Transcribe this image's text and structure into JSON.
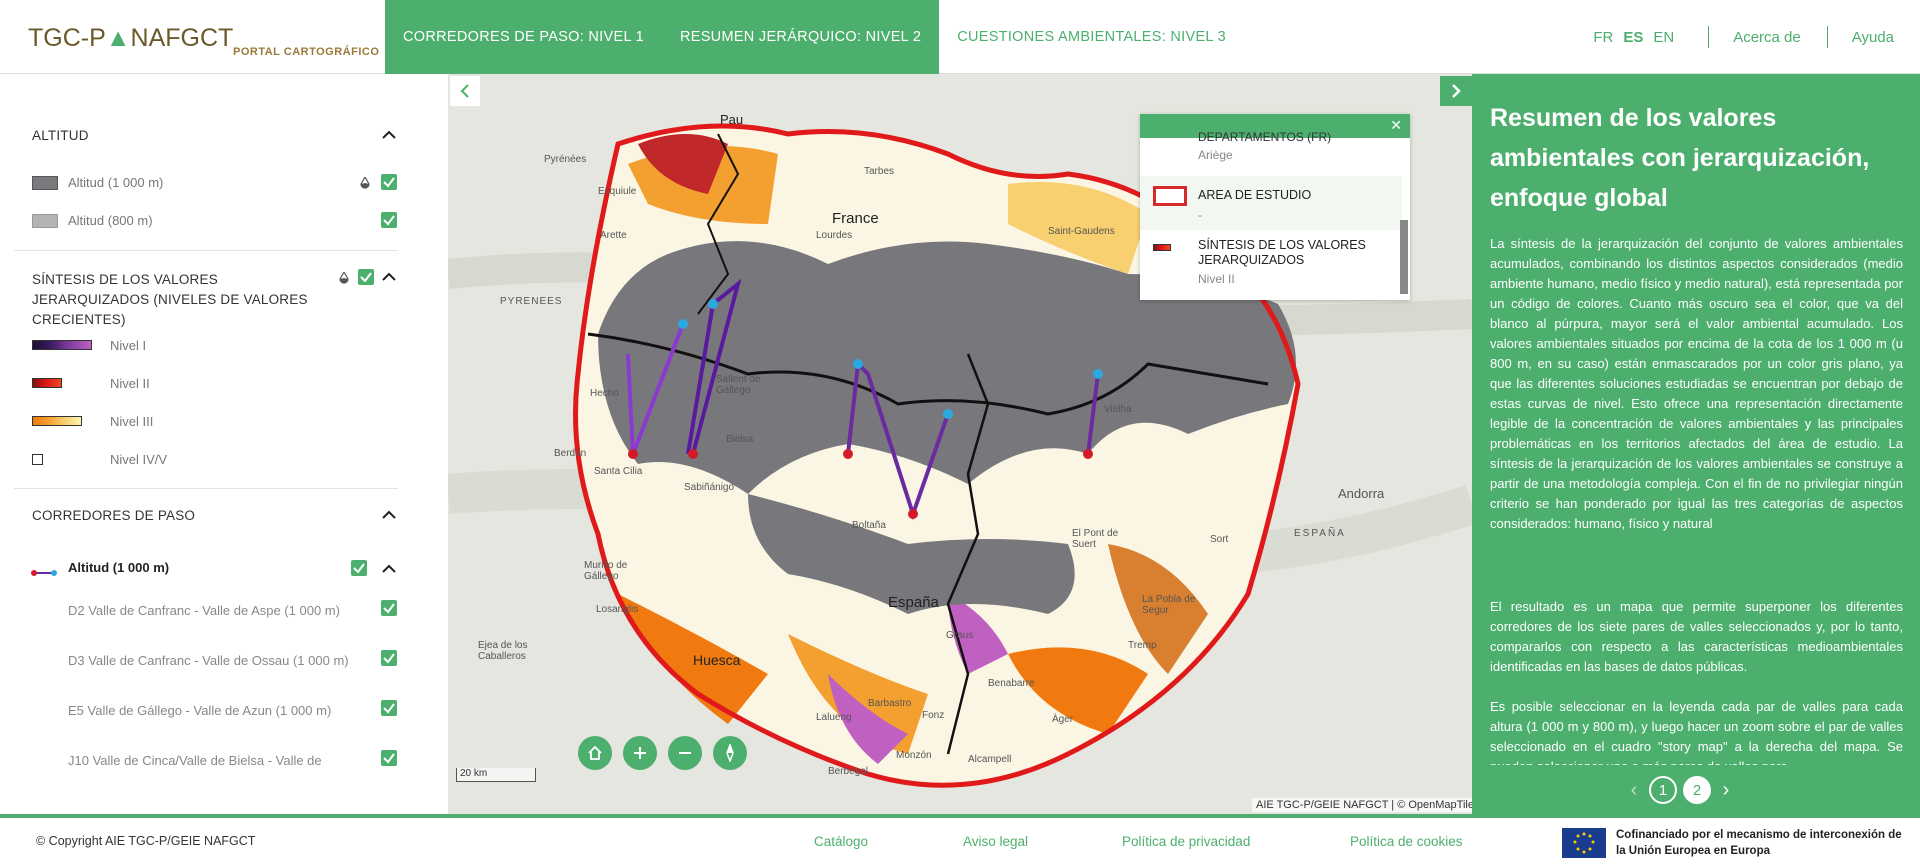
{
  "header": {
    "brand_left": "TGC-P",
    "brand_right": "NAFGCT",
    "portal": "PORTAL CARTOGRÁFICO",
    "tabs": [
      {
        "label": "CORREDORES DE PASO: NIVEL 1"
      },
      {
        "label": "RESUMEN JERÁRQUICO: NIVEL 2"
      },
      {
        "label": "CUESTIONES AMBIENTALES: NIVEL 3"
      }
    ],
    "langs": [
      "FR",
      "ES",
      "EN"
    ],
    "about": "Acerca de",
    "help": "Ayuda"
  },
  "left": {
    "altitud": {
      "title": "ALTITUD",
      "items": [
        {
          "label": "Altitud (1 000 m)",
          "color": "#7a7a7e"
        },
        {
          "label": "Altitud (800 m)",
          "color": "#b4b4b6"
        }
      ]
    },
    "sintesis": {
      "title": "SÍNTESIS DE LOS VALORES JERARQUIZADOS (NIVELES DE VALORES CRECIENTES)",
      "items": [
        {
          "label": "Nivel I"
        },
        {
          "label": "Nivel II"
        },
        {
          "label": "Nivel III"
        },
        {
          "label": "Nivel IV/V"
        }
      ]
    },
    "corredores": {
      "title": "CORREDORES DE PASO",
      "group": "Altitud (1 000 m)",
      "items": [
        {
          "label": "D2 Valle de Canfranc - Valle de Aspe (1 000 m)"
        },
        {
          "label": "D3 Valle de Canfranc - Valle de Ossau (1 000 m)"
        },
        {
          "label": "E5 Valle de Gállego - Valle de Azun (1 000 m)"
        },
        {
          "label": "J10 Valle de Cinca/Valle de Bielsa - Valle de"
        }
      ]
    }
  },
  "map": {
    "popup": {
      "item0_title": "DEPARTAMENTOS (FR)",
      "item0_sub": "Ariège",
      "item1_title": "AREA DE ESTUDIO",
      "item1_sub": "-",
      "item2_title": "SÍNTESIS DE LOS VALORES JERARQUIZADOS",
      "item2_sub": "Nivel II"
    },
    "scale": "20 km",
    "attribution": "AIE TGC-P/GEIE NAFGCT | © OpenMapTiles ©",
    "labels": {
      "pau": "Pau",
      "france": "France",
      "espana": "España",
      "huesca": "Huesca",
      "andorra": "Andorra",
      "tarbes": "Tarbes",
      "lourdes": "Lourdes",
      "esquiule": "Esquiule",
      "arette": "Arette",
      "hecho": "Hecho",
      "berdun": "Berdún",
      "santacilia": "Santa Cilia",
      "boltana": "Boltaña",
      "graus": "Graus",
      "barbastro": "Barbastro",
      "fonz": "Fonz",
      "monzon": "Monzón",
      "sort": "Sort",
      "vielha": "Vielha",
      "tremp": "Tremp",
      "ager": "Àger",
      "losanglis": "Losanglis",
      "lalueng": "Lalueng",
      "berbegal": "Berbegal",
      "murillo": "Murillo de Gállego",
      "ejea": "Ejea de los Caballeros",
      "pobla": "La Pobla de Segur",
      "pont": "El Pont de Suert",
      "espana2": "ESPAÑA",
      "benabarre": "Benabarre",
      "alcampell": "Alcampell",
      "bielsa": "Bielsa",
      "sallent": "Sallent de Gállego",
      "sabinanigo": "Sabiñánigo",
      "pyrenees": "Pyrénées",
      "pyrenees2": "PYRENEES",
      "saintgaudens": "Saint-Gaudens"
    }
  },
  "right": {
    "title": "Resumen de los valores ambientales con jerarquización, enfoque global",
    "p1": "La síntesis de la jerarquización del conjunto de valores ambientales acumulados, combinando los distintos aspectos considerados (medio ambiente humano, medio físico y medio natural), está representada por un código de colores. Cuanto más oscuro sea el color, que va del blanco al púrpura, mayor será el valor ambiental acumulado. Los valores ambientales situados por encima de la cota de los 1 000 m (u 800 m, en su caso) están enmascarados por un color gris plano, ya que las diferentes soluciones estudiadas se encuentran por debajo de estas curvas de nivel. Esto ofrece una representación directamente legible de la concentración de valores ambientales y las principales problemáticas en los territorios afectados del área de estudio. La síntesis de la jerarquización de los valores ambientales se construye a partir de una metodología compleja. Con el fin de no privilegiar ningún criterio se han ponderado por igual las tres categorías de aspectos considerados: humano, físico y natural",
    "p2": "El resultado es un mapa que permite superponer los diferentes corredores de los siete pares de valles seleccionados y, por lo tanto, compararlos con respecto a las características medioambientales identificadas en las bases de datos públicas.",
    "p3": "Es posible seleccionar en la leyenda cada par de valles para cada altura (1 000 m y 800 m), y luego hacer un zoom sobre el par de valles seleccionado en el cuadro \"story map\" a la derecha del mapa. Se pueden seleccionar uno o más pares de valles para",
    "pages": [
      "1",
      "2"
    ]
  },
  "footer": {
    "copyright": "© Copyright AIE TGC-P/GEIE NAFGCT",
    "links": [
      "Catálogo",
      "Aviso legal",
      "Política de privacidad",
      "Política de cookies"
    ],
    "eu_text": "Cofinanciado por el mecanismo de interconexión de la Unión Europea en Europa"
  }
}
